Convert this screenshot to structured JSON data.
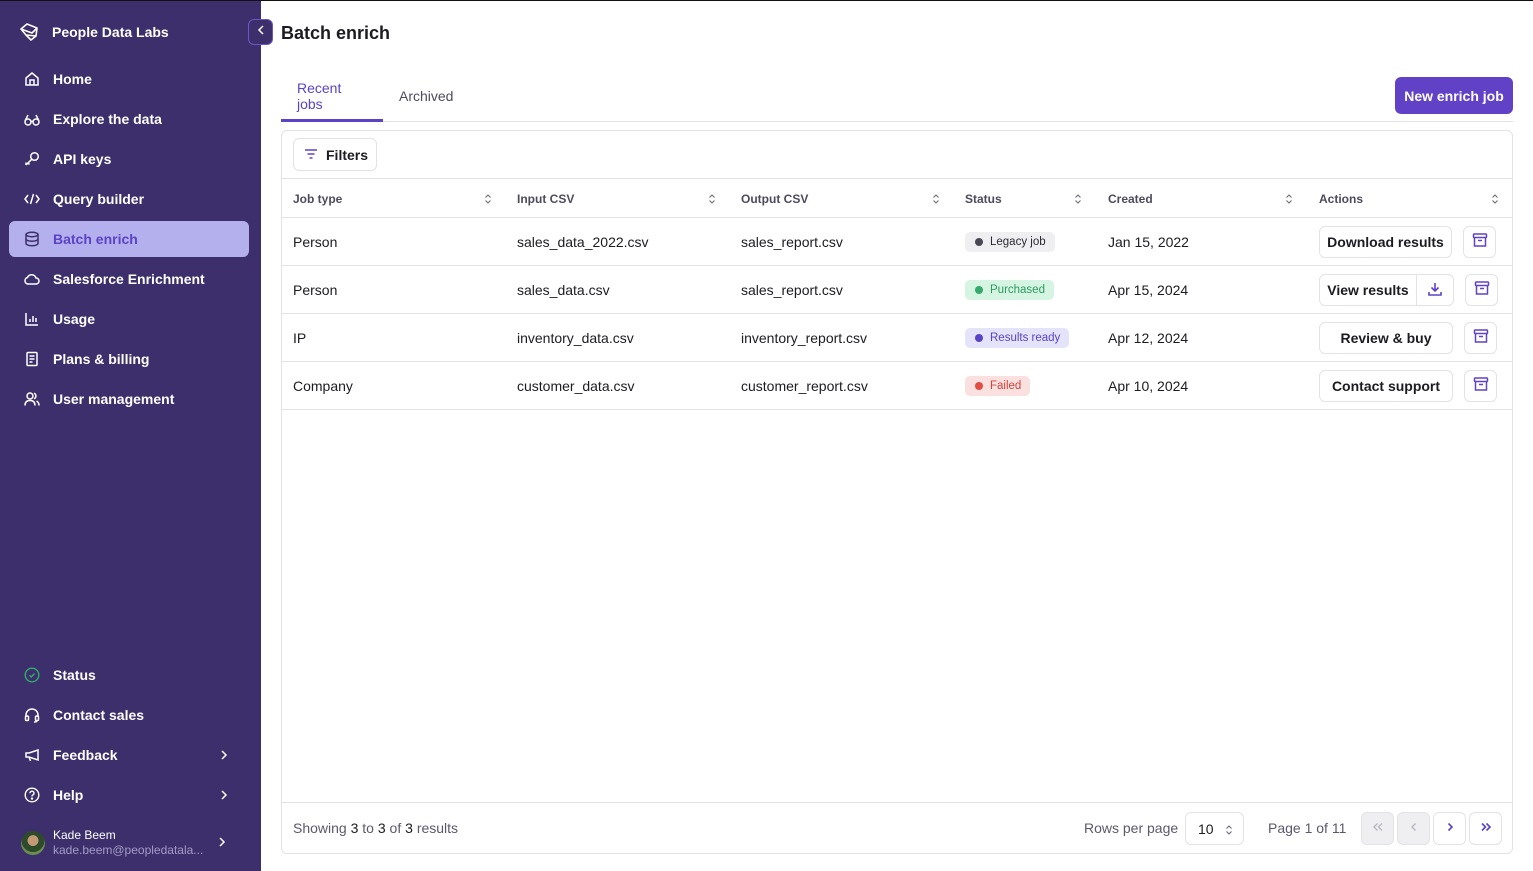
{
  "app": {
    "brand": "People Data Labs",
    "brand_icon": "pdl-logo-icon"
  },
  "sidebar": {
    "collapse_icon": "chevron-left-icon",
    "items": [
      {
        "label": "Home",
        "icon": "home-icon",
        "active": false
      },
      {
        "label": "Explore the data",
        "icon": "glasses-icon",
        "active": false
      },
      {
        "label": "API keys",
        "icon": "key-icon",
        "active": false
      },
      {
        "label": "Query builder",
        "icon": "code-icon",
        "active": false
      },
      {
        "label": "Batch enrich",
        "icon": "database-icon",
        "active": true
      },
      {
        "label": "Salesforce Enrichment",
        "icon": "cloud-icon",
        "active": false
      },
      {
        "label": "Usage",
        "icon": "bar-chart-icon",
        "active": false
      },
      {
        "label": "Plans & billing",
        "icon": "receipt-icon",
        "active": false
      },
      {
        "label": "User management",
        "icon": "users-icon",
        "active": false
      }
    ],
    "bottom_items": [
      {
        "label": "Status",
        "icon": "check-circle-icon",
        "status_color": "#2fae6b"
      },
      {
        "label": "Contact sales",
        "icon": "headset-icon"
      },
      {
        "label": "Feedback",
        "icon": "megaphone-icon",
        "has_chevron": true
      },
      {
        "label": "Help",
        "icon": "help-circle-icon",
        "has_chevron": true
      }
    ],
    "user": {
      "name": "Kade Beem",
      "email": "kade.beem@peopledatala..."
    }
  },
  "header": {
    "title": "Batch enrich",
    "new_job_label": "New enrich job"
  },
  "tabs": [
    {
      "label": "Recent jobs",
      "active": true
    },
    {
      "label": "Archived",
      "active": false
    }
  ],
  "toolbar": {
    "filters_label": "Filters"
  },
  "table": {
    "columns": [
      "Job type",
      "Input CSV",
      "Output CSV",
      "Status",
      "Created",
      "Actions"
    ],
    "rows": [
      {
        "job_type": "Person",
        "input": "sales_data_2022.csv",
        "output": "sales_report.csv",
        "status": "Legacy job",
        "status_kind": "legacy",
        "created": "Jan 15, 2022",
        "action": "Download results",
        "has_download": false
      },
      {
        "job_type": "Person",
        "input": "sales_data.csv",
        "output": "sales_report.csv",
        "status": "Purchased",
        "status_kind": "purchased",
        "created": "Apr 15, 2024",
        "action": "View results",
        "has_download": true
      },
      {
        "job_type": "IP",
        "input": "inventory_data.csv",
        "output": "inventory_report.csv",
        "status": "Results ready",
        "status_kind": "ready",
        "created": "Apr 12, 2024",
        "action": "Review & buy",
        "has_download": false
      },
      {
        "job_type": "Company",
        "input": "customer_data.csv",
        "output": "customer_report.csv",
        "status": "Failed",
        "status_kind": "failed",
        "created": "Apr 10, 2024",
        "action": "Contact support",
        "has_download": false
      }
    ]
  },
  "status_colors": {
    "legacy": {
      "bg": "#efeff2",
      "dot": "#4a4757",
      "text": "#2c2a35"
    },
    "purchased": {
      "bg": "#d5f5e2",
      "dot": "#36a96c",
      "text": "#2e9a60"
    },
    "ready": {
      "bg": "#e5e3fa",
      "dot": "#5a43c6",
      "text": "#5a43c6"
    },
    "failed": {
      "bg": "#fbe0e0",
      "dot": "#e04e44",
      "text": "#d0443b"
    }
  },
  "footer": {
    "showing_prefix": "Showing",
    "from": "3",
    "to_word": "to",
    "to": "3",
    "of_word": "of",
    "total": "3",
    "suffix": "results",
    "rows_per_page_label": "Rows per page",
    "rows_per_page_value": "10",
    "page_label": "Page 1 of 11"
  },
  "colors": {
    "sidebar_bg": "#3c2f6b",
    "accent": "#6142c6",
    "active_nav_bg": "#b4b0ee"
  }
}
